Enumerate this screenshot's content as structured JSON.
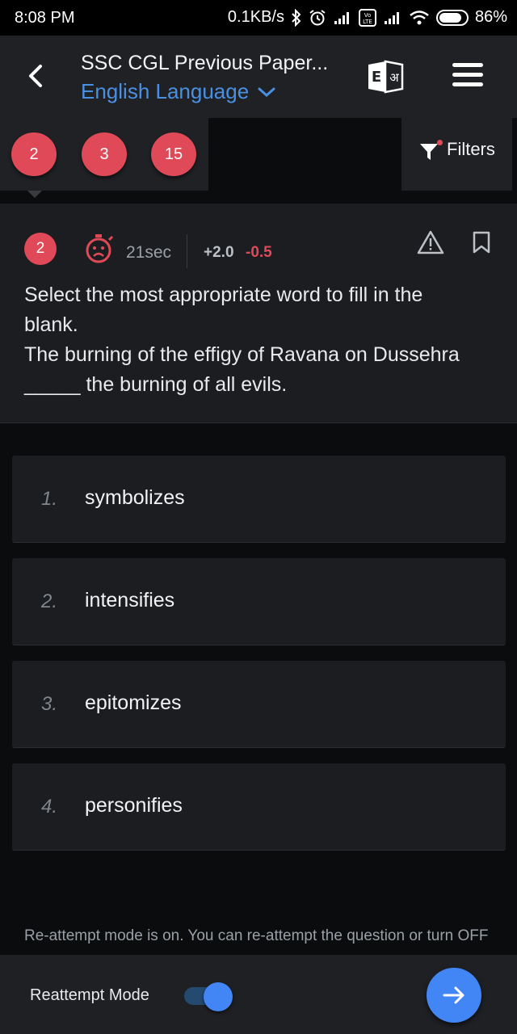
{
  "status_bar": {
    "time": "8:08 PM",
    "network_speed": "0.1KB/s",
    "battery_percent": "86%",
    "battery_level": 0.86,
    "icons": [
      "bluetooth-icon",
      "alarm-icon",
      "signal-icon",
      "volte-icon",
      "signal-icon",
      "wifi-icon",
      "battery-icon"
    ]
  },
  "header": {
    "title": "SSC CGL Previous Paper...",
    "subtitle": "English Language",
    "lang_icon_letters": [
      "E",
      "अ"
    ]
  },
  "question_tabs": [
    "2",
    "3",
    "15"
  ],
  "filters_label": "Filters",
  "question": {
    "number": "2",
    "time": "21sec",
    "positive_marks": "+2.0",
    "negative_marks": "-0.5",
    "lines": [
      "Select the most appropriate word to fill in the",
      "blank.",
      "The burning of the effigy of Ravana on Dussehra",
      "_____ the burning of all evils."
    ]
  },
  "options": [
    {
      "num": "1.",
      "text": "symbolizes"
    },
    {
      "num": "2.",
      "text": "intensifies"
    },
    {
      "num": "3.",
      "text": "epitomizes"
    },
    {
      "num": "4.",
      "text": "personifies"
    }
  ],
  "notice": "Re-attempt mode is on. You can re-attempt the question or turn OFF",
  "bottom_bar": {
    "reattempt_label": "Reattempt Mode",
    "reattempt_on": true
  },
  "colors": {
    "accent_blue": "#4285f4",
    "accent_red": "#e04a58",
    "background": "#0b0c0e",
    "card": "#1c1d21"
  }
}
